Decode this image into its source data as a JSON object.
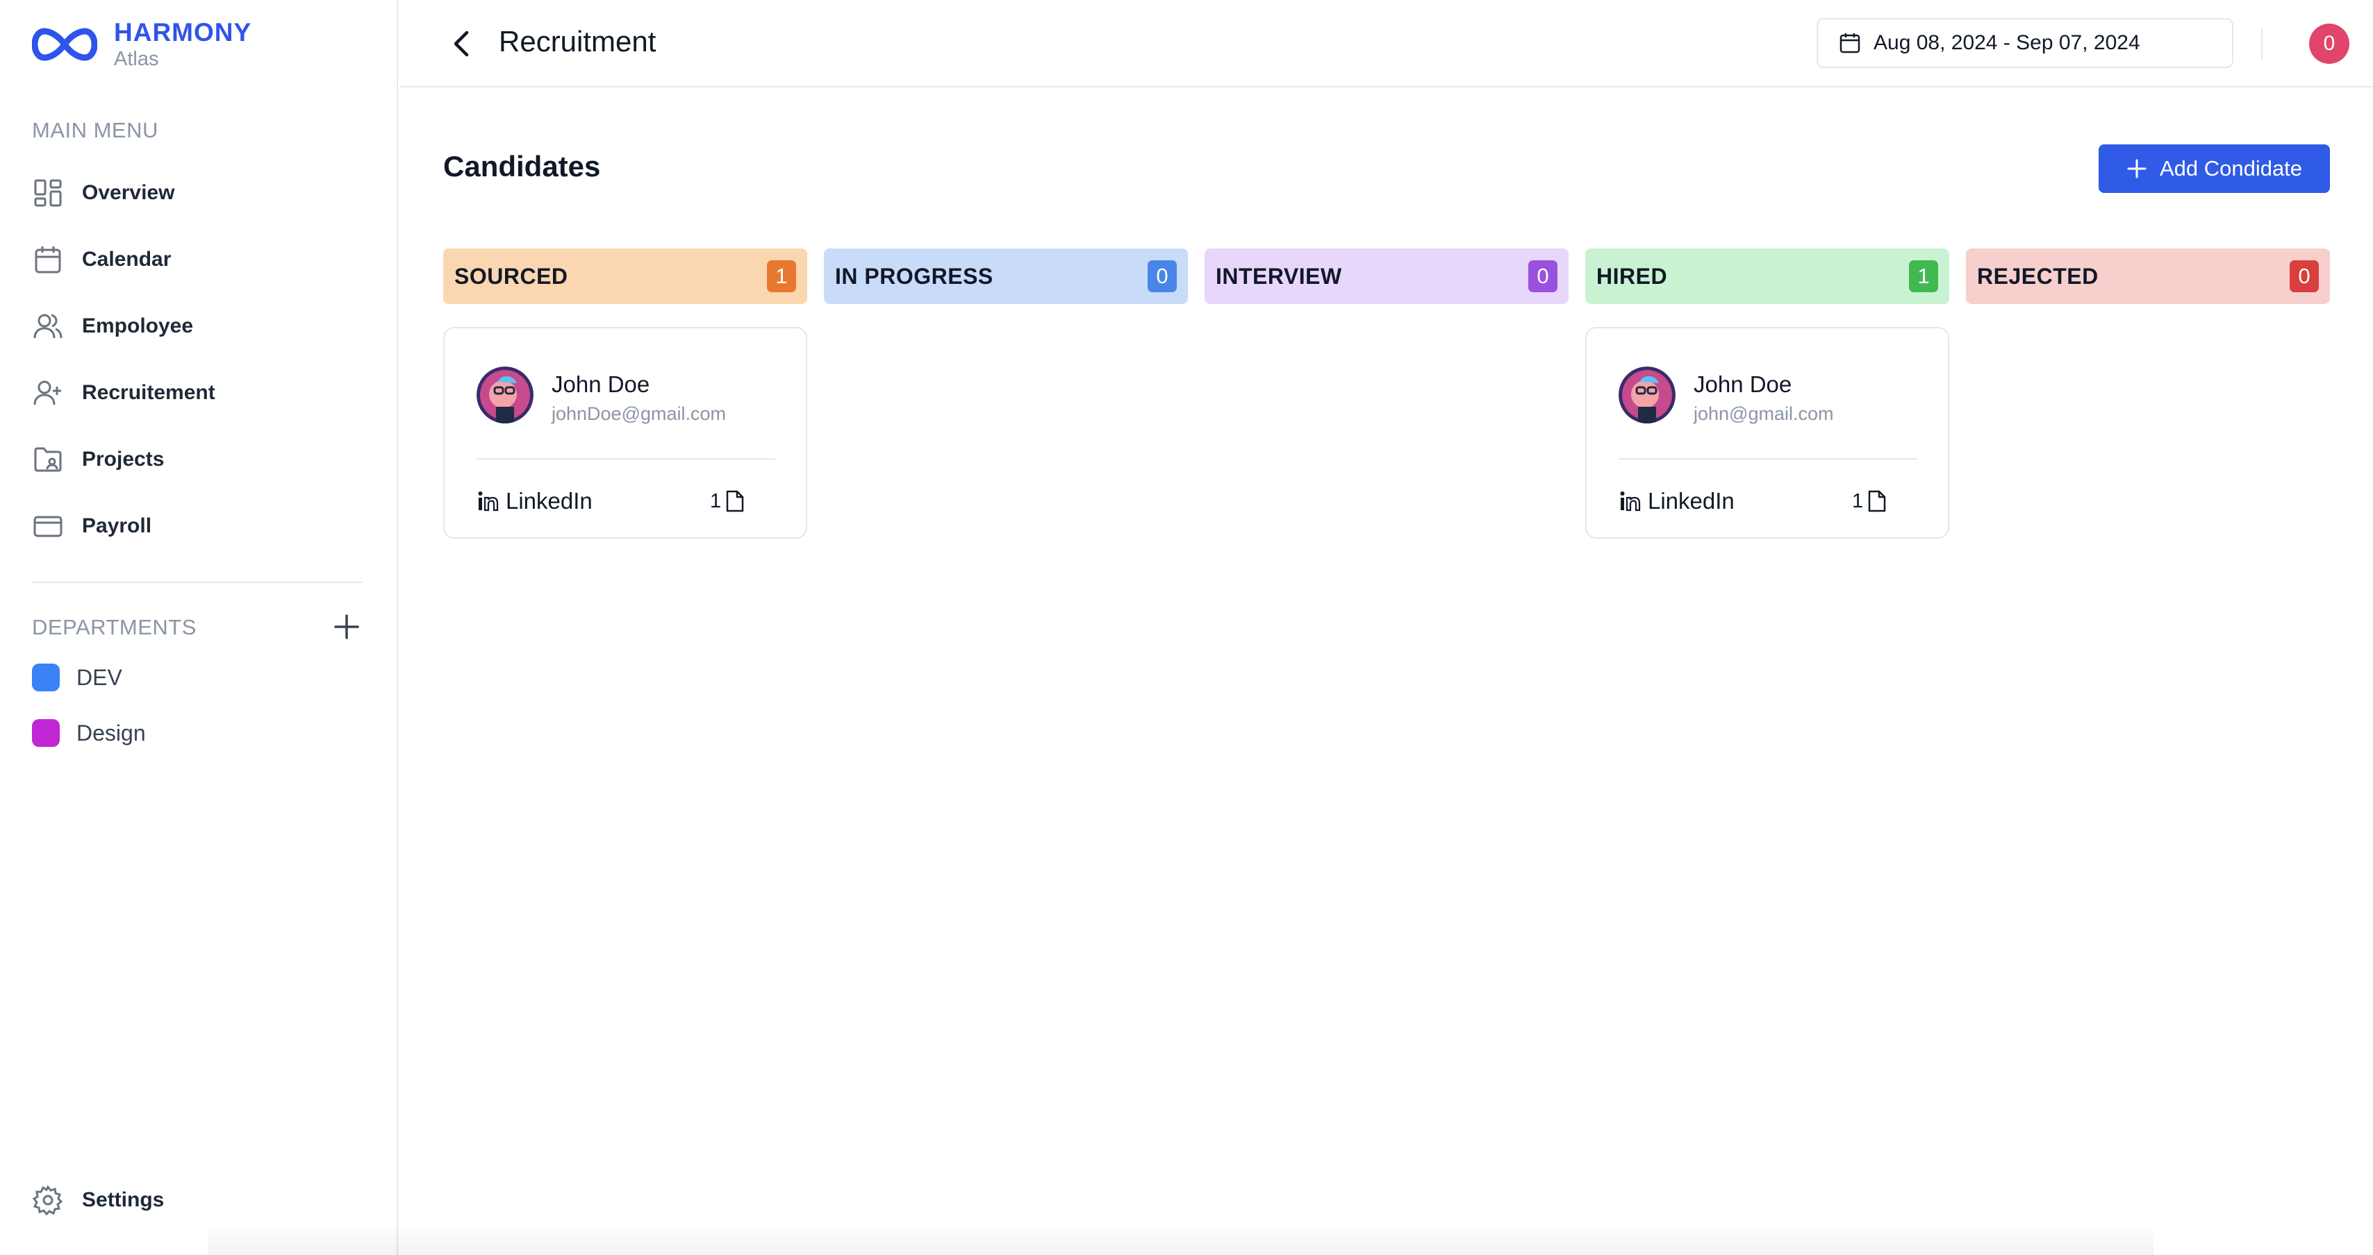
{
  "brand": {
    "name": "HARMONY",
    "sub": "Atlas"
  },
  "sidebar": {
    "main_menu_label": "MAIN MENU",
    "items": [
      {
        "label": "Overview",
        "icon": "grid-icon"
      },
      {
        "label": "Calendar",
        "icon": "calendar-icon"
      },
      {
        "label": "Empoloyee",
        "icon": "users-icon"
      },
      {
        "label": "Recruitement",
        "icon": "user-plus-icon"
      },
      {
        "label": "Projects",
        "icon": "folder-icon"
      },
      {
        "label": "Payroll",
        "icon": "credit-card-icon"
      }
    ],
    "departments_label": "DEPARTMENTS",
    "departments": [
      {
        "label": "DEV",
        "color": "#3b82f6"
      },
      {
        "label": "Design",
        "color": "#c026d3"
      }
    ],
    "settings_label": "Settings"
  },
  "header": {
    "title": "Recruitment",
    "date_range": "Aug 08, 2024 - Sep 07, 2024",
    "notification_count": "0"
  },
  "main": {
    "title": "Candidates",
    "add_button_label": "Add Condidate",
    "columns": [
      {
        "title": "SOURCED",
        "count": "1",
        "bg": "#fad7b0",
        "badge": "#e8782f"
      },
      {
        "title": "IN PROGRESS",
        "count": "0",
        "bg": "#c8dbf8",
        "badge": "#4a86e8"
      },
      {
        "title": "INTERVIEW",
        "count": "0",
        "bg": "#e7d7fa",
        "badge": "#9b51e0"
      },
      {
        "title": "HIRED",
        "count": "1",
        "bg": "#c9f2d3",
        "badge": "#3fb950"
      },
      {
        "title": "REJECTED",
        "count": "0",
        "bg": "#f7cfcd",
        "badge": "#d93f3c"
      }
    ],
    "cards": [
      {
        "name": "John Doe",
        "email": "johnDoe@gmail.com",
        "source": "LinkedIn",
        "docs": "1"
      },
      {
        "name": "John Doe",
        "email": "john@gmail.com",
        "source": "LinkedIn",
        "docs": "1"
      }
    ]
  }
}
